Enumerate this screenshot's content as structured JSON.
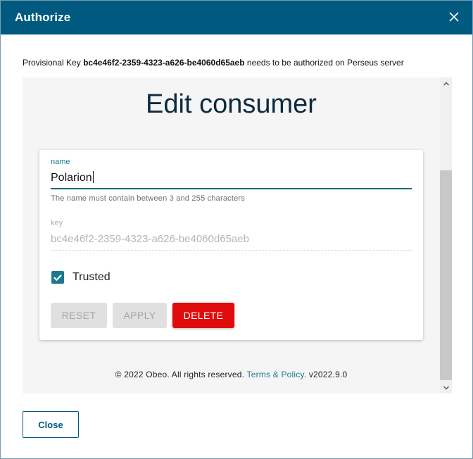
{
  "dialog": {
    "title": "Authorize",
    "close_icon": "close-icon",
    "message": {
      "prefix": "Provisional Key",
      "key": "bc4e46f2-2359-4323-a626-be4060d65aeb",
      "suffix": "needs to be authorized on Perseus server"
    },
    "close_button": "Close"
  },
  "form": {
    "heading": "Edit consumer",
    "name": {
      "label": "name",
      "value": "Polarion",
      "helper": "The name must contain between 3 and 255 characters"
    },
    "key": {
      "label": "key",
      "value": "bc4e46f2-2359-4323-a626-be4060d65aeb"
    },
    "trusted": {
      "label": "Trusted",
      "checked": true
    },
    "buttons": {
      "reset": "RESET",
      "apply": "APPLY",
      "delete": "DELETE"
    }
  },
  "footer": {
    "copyright": "© 2022 Obeo. All rights reserved.",
    "link": "Terms & Policy.",
    "version": "v2022.9.0"
  },
  "colors": {
    "titlebar": "#005a80",
    "accent": "#1b7a8e",
    "delete": "#e00b0b"
  }
}
